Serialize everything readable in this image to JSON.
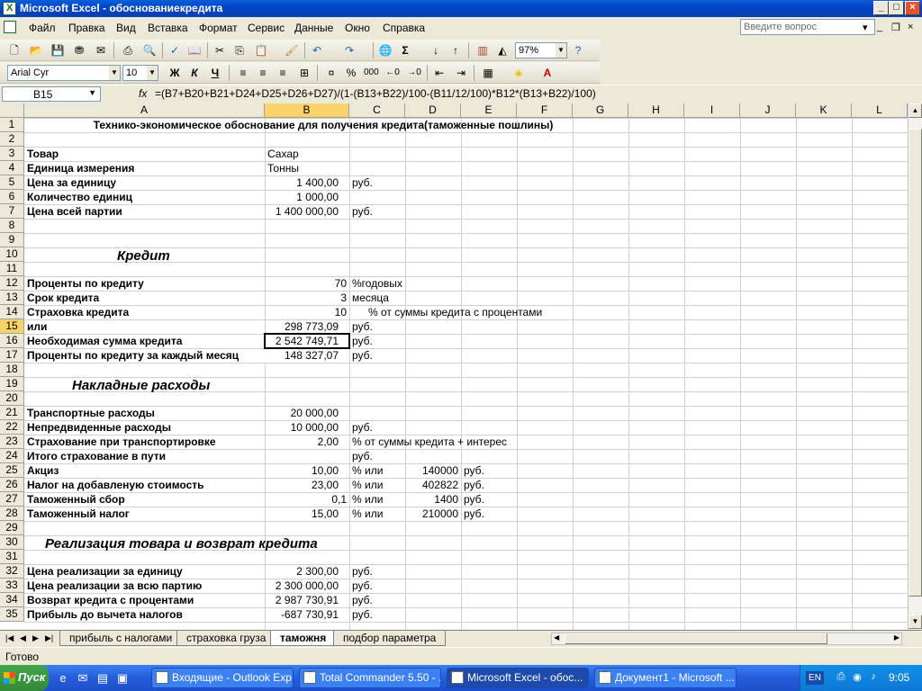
{
  "window": {
    "title": "Microsoft Excel - обоснованиекредита",
    "minimize": "_",
    "maximize": "□",
    "close": "×"
  },
  "menu": {
    "items": [
      "Файл",
      "Правка",
      "Вид",
      "Вставка",
      "Формат",
      "Сервис",
      "Данные",
      "Окно",
      "Справка"
    ],
    "help_placeholder": "Введите вопрос",
    "doc_minimize": "_",
    "doc_restore": "❐",
    "doc_close": "×"
  },
  "toolbar": {
    "zoom": "97%",
    "font": "Arial Cyr",
    "size": "10",
    "bold": "Ж",
    "italic": "К",
    "underline": "Ч",
    "percent": "%",
    "thousands": "000",
    "sum": "Σ"
  },
  "formula_bar": {
    "cell_ref": "B15",
    "fx": "fx",
    "formula": "=(B7+B20+B21+D24+D25+D26+D27)/(1-(B13+B22)/100-(B11/12/100)*B12*(B13+B22)/100)"
  },
  "columns": [
    "A",
    "B",
    "C",
    "D",
    "E",
    "F",
    "G",
    "H",
    "I",
    "J",
    "K",
    "L"
  ],
  "rows": [
    "1",
    "2",
    "3",
    "4",
    "5",
    "6",
    "7",
    "8",
    "9",
    "10",
    "11",
    "12",
    "13",
    "14",
    "15",
    "16",
    "17",
    "18",
    "19",
    "20",
    "21",
    "22",
    "23",
    "24",
    "25",
    "26",
    "27",
    "28",
    "29",
    "30",
    "31",
    "32",
    "33",
    "34",
    "35"
  ],
  "cells": {
    "title": "Технико-экономическое обоснование для получения кредита(таможенные пошлины)",
    "a3": "Товар",
    "b3": "Сахар",
    "a4": "Единица измерения",
    "b4": "Тонны",
    "a5": "Цена за единицу",
    "b5": "1 400,00",
    "c5": "руб.",
    "a6": "Количество единиц",
    "b6": "1 000,00",
    "a7": "Цена всей партии",
    "b7": "1 400 000,00",
    "c7": "руб.",
    "a9": "Кредит",
    "a11": "Проценты по кредиту",
    "b11": "70",
    "c11": "%годовых",
    "a12": "Срок кредита",
    "b12": "3",
    "c12": "месяца",
    "a13": "Страховка кредита",
    "b13": "10",
    "c13": "% от суммы кредита с процентами",
    "a14": "или",
    "b14": "298 773,09",
    "c14": "руб.",
    "a15": "Необходимая сумма кредита",
    "b15": "2 542 749,71",
    "c15": "руб.",
    "a16": "Проценты по кредиту за каждый месяц",
    "b16": "148 327,07",
    "c16": "руб.",
    "a18": "Накладные расходы",
    "a20": "Транспортные расходы",
    "b20": "20 000,00",
    "a21": "Непредвиденные расходы",
    "b21": "10 000,00",
    "c21": "руб.",
    "a22": "Страхование при транспортировке",
    "b22": "2,00",
    "c22": "% от суммы кредита + интерес",
    "a23": "Итого страхование в пути",
    "c23": "руб.",
    "a24": "Акциз",
    "b24": "10,00",
    "c24": "% или",
    "d24": "140000",
    "e24": "руб.",
    "a25": "Налог на добавленую стоимость",
    "b25": "23,00",
    "c25": "% или",
    "d25": "402822",
    "e25": "руб.",
    "a26": "Таможенный сбор",
    "b26": "0,1",
    "c26": "% или",
    "d26": "1400",
    "e26": "руб.",
    "a27": "Таможенный налог",
    "b27": "15,00",
    "c27": "% или",
    "d27": "210000",
    "e27": "руб.",
    "a29": "Реализация товара и возврат кредита",
    "a31": "Цена реализации за единицу",
    "b31": "2 300,00",
    "c31": "руб.",
    "a32": "Цена реализации за всю партию",
    "b32": "2 300 000,00",
    "c32": "руб.",
    "a33": "Возврат кредита с процентами",
    "b33": "2 987 730,91",
    "c33": "руб.",
    "a34": "Прибыль до вычета налогов",
    "b34": "-687 730,91",
    "c34": "руб."
  },
  "sheet_tabs": [
    "прибыль с налогами",
    "страховка груза",
    "таможня",
    "подбор параметра"
  ],
  "status": "Готово",
  "taskbar": {
    "start": "Пуск",
    "tasks": [
      "Входящие - Outlook Exp...",
      "Total Commander 5.50 - ...",
      "Microsoft Excel - обос...",
      "Документ1 - Microsoft ..."
    ],
    "lang": "EN",
    "clock": "9:05"
  }
}
